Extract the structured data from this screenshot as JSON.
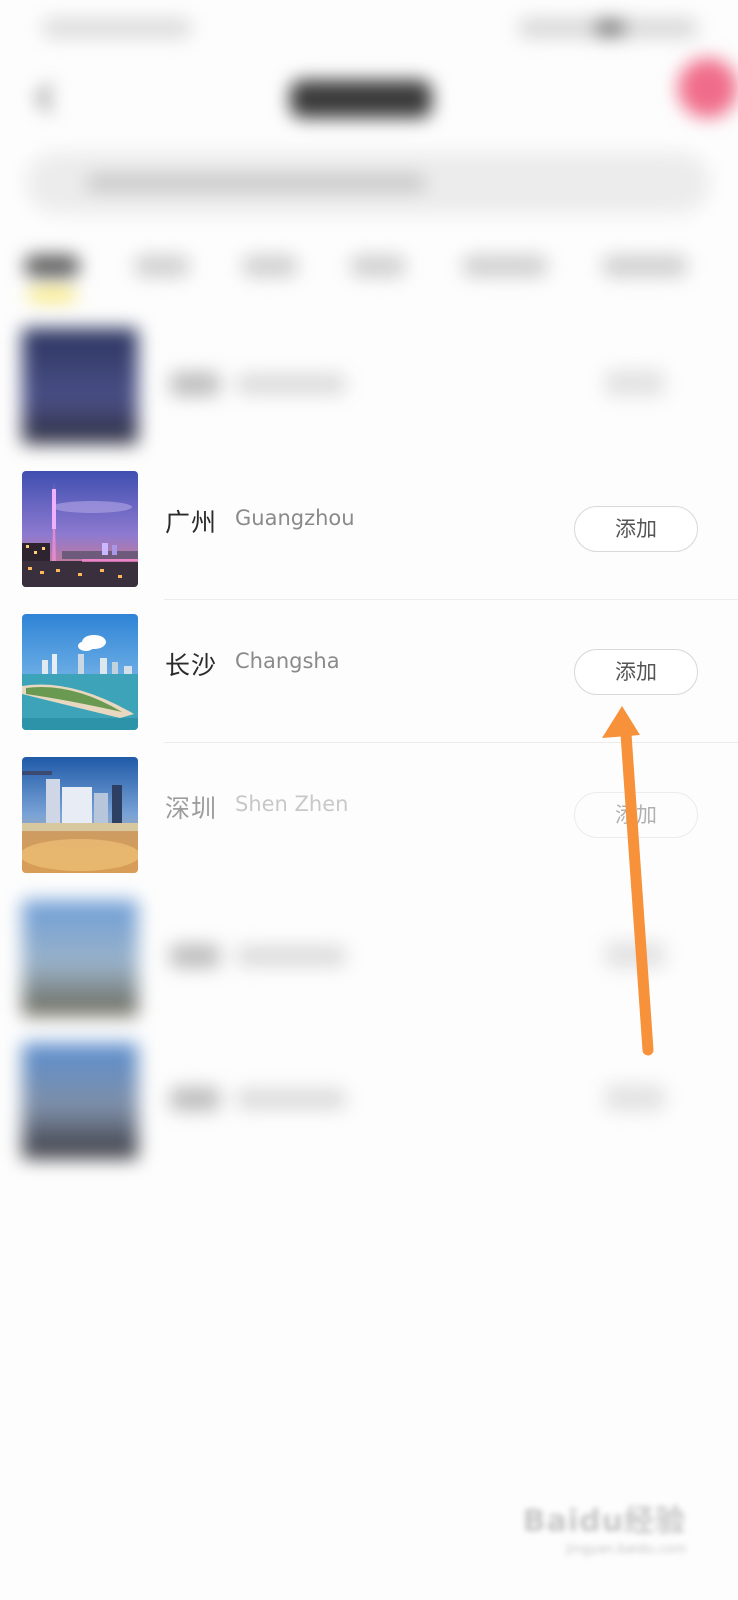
{
  "cities": [
    {
      "cn": "广州",
      "en": "Guangzhou",
      "add_label": "添加"
    },
    {
      "cn": "长沙",
      "en": "Changsha",
      "add_label": "添加"
    },
    {
      "cn": "深圳",
      "en": "Shen Zhen",
      "add_label": "添加"
    }
  ],
  "watermark": {
    "logo": "Baidu经验",
    "url": "jingyan.baidu.com"
  },
  "colors": {
    "arrow": "#f7913a",
    "tab_indicator": "#f6e04b",
    "badge": "#f06d8a"
  }
}
